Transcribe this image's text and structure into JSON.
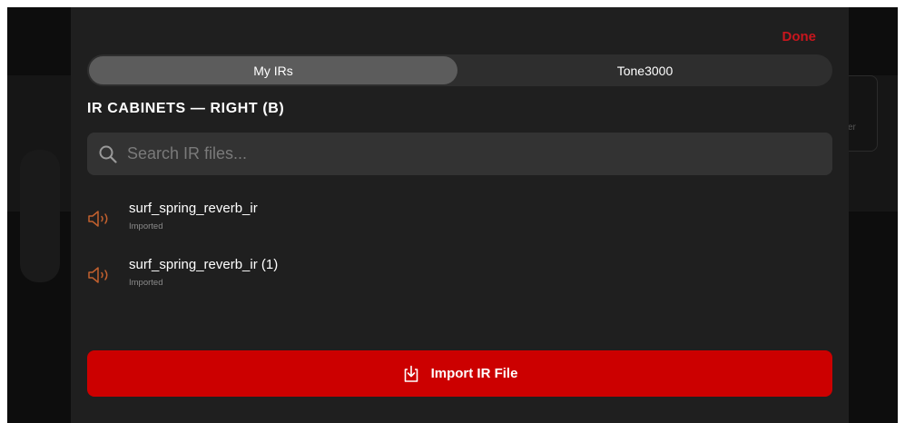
{
  "header": {
    "done_label": "Done"
  },
  "tabs": [
    {
      "label": "My IRs",
      "active": true
    },
    {
      "label": "Tone3000",
      "active": false
    }
  ],
  "section": {
    "title": "IR CABINETS — RIGHT (B)"
  },
  "search": {
    "placeholder": "Search IR files...",
    "value": ""
  },
  "ir_files": [
    {
      "name": "surf_spring_reverb_ir",
      "status": "Imported",
      "icon": "speaker-icon"
    },
    {
      "name": "surf_spring_reverb_ir (1)",
      "status": "Imported",
      "icon": "speaker-icon"
    }
  ],
  "import": {
    "label": "Import IR File",
    "icon": "import-icon"
  },
  "background": {
    "card_text": "er"
  },
  "colors": {
    "accent": "#cc0000",
    "done": "#c8161d",
    "icon_orange": "#c2602e",
    "sheet_bg": "#1f1f1f"
  }
}
